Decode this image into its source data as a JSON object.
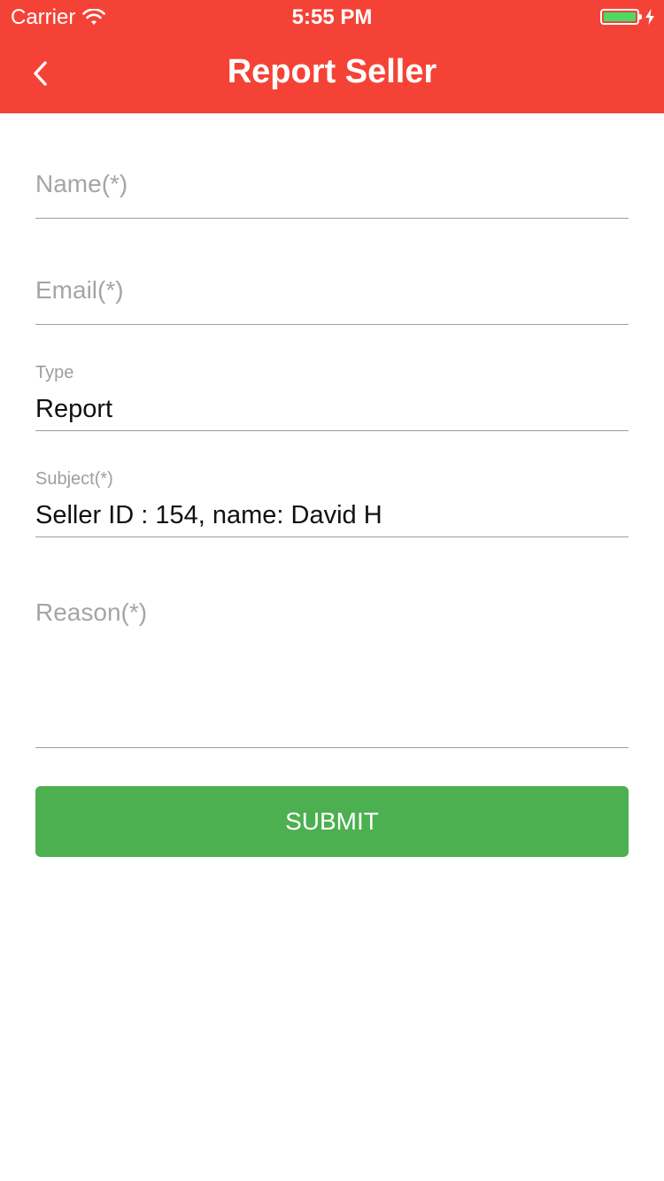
{
  "status_bar": {
    "carrier": "Carrier",
    "time": "5:55 PM",
    "battery_level_percent": 100,
    "battery_color": "#4cd964",
    "charging": true
  },
  "header": {
    "title": "Report Seller",
    "background_color": "#f44336",
    "back_icon": "chevron-left-icon"
  },
  "form": {
    "name": {
      "placeholder": "Name(*)",
      "value": ""
    },
    "email": {
      "placeholder": "Email(*)",
      "value": ""
    },
    "type": {
      "label": "Type",
      "value": "Report"
    },
    "subject": {
      "label": "Subject(*)",
      "value": "Seller ID : 154, name: David H"
    },
    "reason": {
      "placeholder": "Reason(*)",
      "value": ""
    },
    "submit_label": "SUBMIT",
    "submit_color": "#4caf50"
  }
}
